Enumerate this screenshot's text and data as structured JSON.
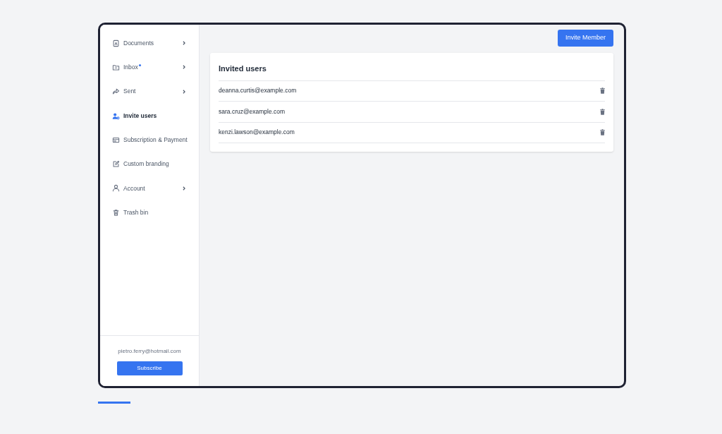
{
  "sidebar": {
    "items": [
      {
        "kind": "document",
        "label": "Documents",
        "selected": false,
        "expandable": true,
        "unread": false
      },
      {
        "kind": "folder",
        "label": "Inbox",
        "selected": false,
        "expandable": true,
        "unread": true
      },
      {
        "kind": "share",
        "label": "Sent",
        "selected": false,
        "expandable": true,
        "unread": false
      },
      {
        "kind": "user-plus",
        "label": "Invite users",
        "selected": true,
        "expandable": false,
        "unread": false
      },
      {
        "kind": "card",
        "label": "Subscription & Payment",
        "selected": false,
        "expandable": false,
        "unread": false
      },
      {
        "kind": "edit",
        "label": "Custom branding",
        "selected": false,
        "expandable": false,
        "unread": false
      },
      {
        "kind": "user",
        "label": "Account",
        "selected": false,
        "expandable": true,
        "unread": false
      },
      {
        "kind": "trash",
        "label": "Trash bin",
        "selected": false,
        "expandable": false,
        "unread": false
      }
    ],
    "email": "pietro.ferry@hotmail.com",
    "subscribe_button": "Subscribe"
  },
  "invite_button": "Invite Member",
  "invited": {
    "title": "Invited users",
    "users": [
      {
        "email": "deanna.curtis@example.com"
      },
      {
        "email": "sara.cruz@example.com"
      },
      {
        "email": "kenzi.lawson@example.com"
      }
    ]
  }
}
